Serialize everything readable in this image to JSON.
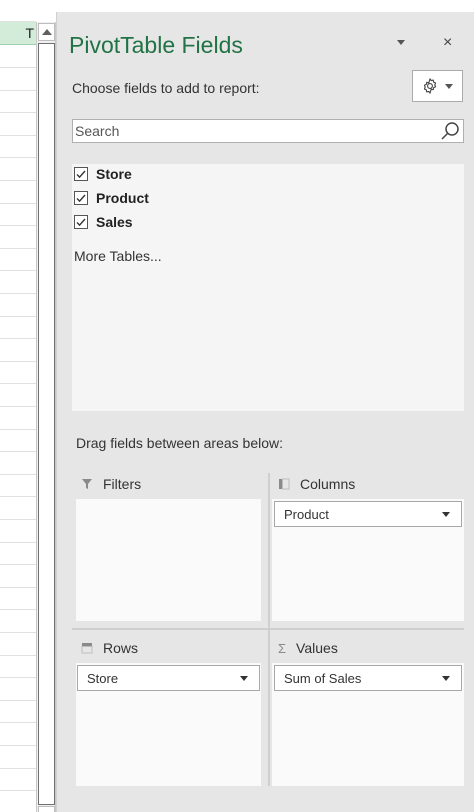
{
  "sheet": {
    "column_header_label": "T"
  },
  "pane": {
    "title": "PivotTable Fields",
    "close_icon": "×",
    "choose_label": "Choose fields to add to report:",
    "search": {
      "placeholder": "Search"
    },
    "fields": [
      {
        "label": "Store",
        "checked": true
      },
      {
        "label": "Product",
        "checked": true
      },
      {
        "label": "Sales",
        "checked": true
      }
    ],
    "more_tables": "More Tables...",
    "drag_label": "Drag fields between areas below:",
    "areas": {
      "filters": {
        "title": "Filters",
        "items": []
      },
      "columns": {
        "title": "Columns",
        "items": [
          "Product"
        ]
      },
      "rows": {
        "title": "Rows",
        "items": [
          "Store"
        ]
      },
      "values": {
        "title": "Values",
        "icon_glyph": "Σ",
        "items": [
          "Sum of Sales"
        ]
      }
    }
  },
  "colors": {
    "accent": "#217346",
    "pane_bg": "#e6e6e6"
  },
  "icons": [
    "chevron-down-icon",
    "close-icon",
    "gear-icon",
    "search-icon",
    "checkbox-checked-icon",
    "filter-icon",
    "columns-icon",
    "rows-icon",
    "sigma-icon"
  ]
}
